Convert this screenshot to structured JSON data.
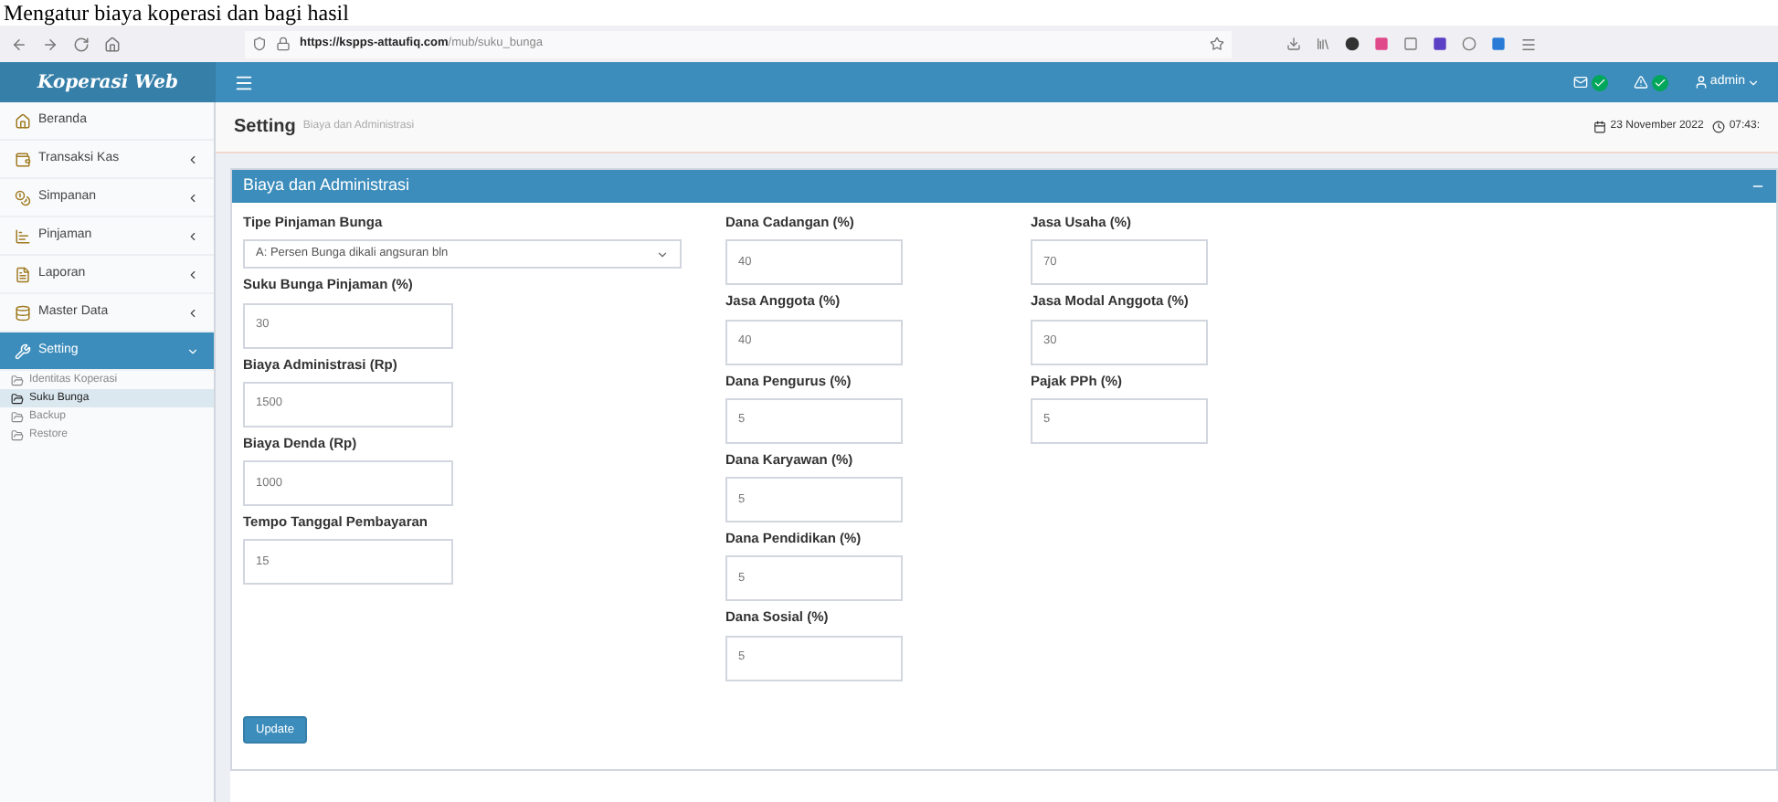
{
  "caption": "Mengatur biaya koperasi dan bagi hasil",
  "browser": {
    "url_host": "https://kspps-attaufiq.com",
    "url_path": "/mub/suku_bunga"
  },
  "app": {
    "brand": "Koperasi Web",
    "user": "admin"
  },
  "sidebar": {
    "items": [
      {
        "label": "Beranda",
        "kind": "link",
        "selected": false
      },
      {
        "label": "Transaksi Kas",
        "kind": "submenu",
        "selected": false,
        "expanded": false
      },
      {
        "label": "Simpanan",
        "kind": "submenu",
        "selected": false,
        "expanded": false
      },
      {
        "label": "Pinjaman",
        "kind": "submenu",
        "selected": false,
        "expanded": false
      },
      {
        "label": "Laporan",
        "kind": "submenu",
        "selected": false,
        "expanded": false
      },
      {
        "label": "Master Data",
        "kind": "submenu",
        "selected": false,
        "expanded": false
      },
      {
        "label": "Setting",
        "kind": "submenu",
        "selected": true,
        "expanded": true,
        "children": [
          {
            "label": "Identitas Koperasi",
            "selected": false
          },
          {
            "label": "Suku Bunga",
            "selected": true
          },
          {
            "label": "Backup",
            "selected": false
          },
          {
            "label": "Restore",
            "selected": false
          }
        ]
      }
    ]
  },
  "page": {
    "title": "Setting",
    "subtitle": "Biaya dan Administrasi",
    "date": "23 November 2022",
    "time": "07:43:"
  },
  "panel": {
    "title": "Biaya dan Administrasi",
    "button": "Update",
    "columns": [
      [
        {
          "label": "Tipe Pinjaman Bunga",
          "value": "A: Persen Bunga dikali angsuran bln",
          "kind": "select"
        },
        {
          "label": "Suku Bunga Pinjaman (%)",
          "value": "30",
          "kind": "input"
        },
        {
          "label": "Biaya Administrasi (Rp)",
          "value": "1500",
          "kind": "input"
        },
        {
          "label": "Biaya Denda (Rp)",
          "value": "1000",
          "kind": "input"
        },
        {
          "label": "Tempo Tanggal Pembayaran",
          "value": "15",
          "kind": "input"
        }
      ],
      [
        {
          "label": "Dana Cadangan (%)",
          "value": "40",
          "kind": "input"
        },
        {
          "label": "Jasa Anggota (%)",
          "value": "40",
          "kind": "input"
        },
        {
          "label": "Dana Pengurus (%)",
          "value": "5",
          "kind": "input"
        },
        {
          "label": "Dana Karyawan (%)",
          "value": "5",
          "kind": "input"
        },
        {
          "label": "Dana Pendidikan (%)",
          "value": "5",
          "kind": "input"
        },
        {
          "label": "Dana Sosial (%)",
          "value": "5",
          "kind": "input"
        }
      ],
      [
        {
          "label": "Jasa Usaha (%)",
          "value": "70",
          "kind": "input"
        },
        {
          "label": "Jasa Modal Anggota (%)",
          "value": "30",
          "kind": "input"
        },
        {
          "label": "Pajak PPh (%)",
          "value": "5",
          "kind": "input"
        }
      ]
    ]
  }
}
